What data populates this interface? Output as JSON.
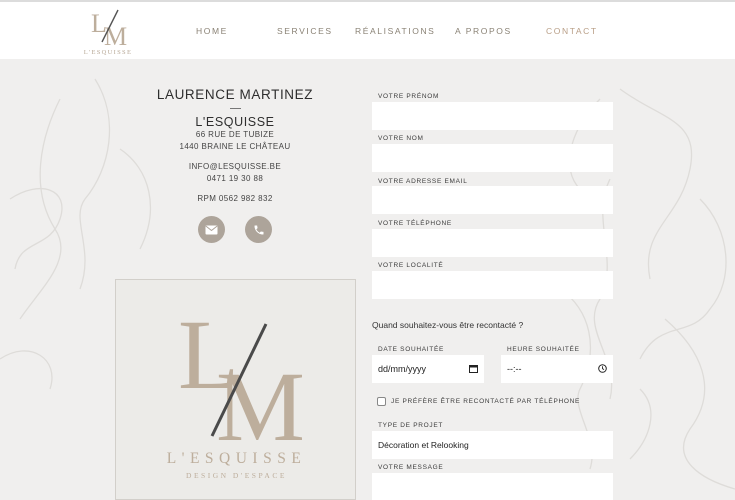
{
  "header": {
    "logo_mark": "L/M",
    "logo_text": "L'ESQUISSE",
    "nav": [
      {
        "label": "HOME",
        "active": false
      },
      {
        "label": "SERVICES",
        "active": false
      },
      {
        "label": "RÉALISATIONS",
        "active": false
      },
      {
        "label": "A PROPOS",
        "active": false
      },
      {
        "label": "CONTACT",
        "active": true
      }
    ]
  },
  "contact": {
    "name": "LAURENCE MARTINEZ",
    "company": "L'ESQUISSE",
    "street": "66 RUE DE TUBIZE",
    "city": "1440 BRAINE LE CHÂTEAU",
    "email": "INFO@LESQUISSE.BE",
    "phone": "0471 19 30 88",
    "rpm": "RPM 0562 982 832",
    "email_button_icon": "mail-icon",
    "phone_button_icon": "phone-icon"
  },
  "logo_card": {
    "brand": "L'ESQUISSE",
    "tagline": "DESIGN D'ESPACE"
  },
  "form": {
    "firstname_label": "VOTRE PRÉNOM",
    "firstname_value": "",
    "lastname_label": "VOTRE NOM",
    "lastname_value": "",
    "email_label": "VOTRE ADRESSE EMAIL",
    "email_value": "",
    "phone_label": "VOTRE TÉLÉPHONE",
    "phone_value": "",
    "locality_label": "VOTRE LOCALITÉ",
    "locality_value": "",
    "question": "Quand souhaitez-vous être recontacté ?",
    "date_label": "DATE SOUHAITÉE",
    "date_placeholder": "dd/mm/yyyy",
    "time_label": "HEURE SOUHAITÉE",
    "time_placeholder": "--:--",
    "checkbox_label": "JE PRÉFÈRE ÊTRE RECONTACTÉ PAR TÉLÉPHONE",
    "checkbox_checked": false,
    "project_label": "TYPE DE PROJET",
    "project_value": "Décoration et Relooking",
    "message_label": "VOTRE MESSAGE",
    "message_value": ""
  },
  "colors": {
    "accent": "#b89e86",
    "background": "#f0efee",
    "button_circle": "#ada49a",
    "logo_beige": "#bdae9c"
  }
}
